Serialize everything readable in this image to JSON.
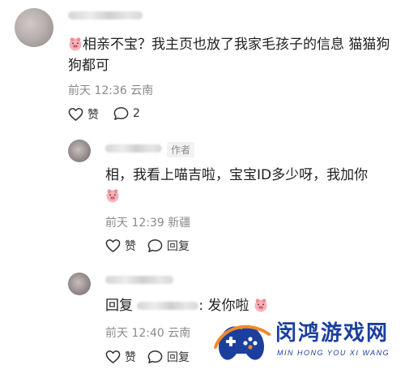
{
  "comment_main": {
    "text": "相亲不宝？我主页也放了我家毛孩子的信息 猫猫狗狗都可",
    "time": "前天 12:36",
    "location": "云南",
    "like_label": "赞",
    "reply_count": "2"
  },
  "reply_1": {
    "author_tag": "作者",
    "text": "相，我看上喵吉啦，宝宝ID多少呀，我加你",
    "time": "前天 12:39",
    "location": "新疆",
    "like_label": "赞",
    "reply_label": "回复"
  },
  "reply_2": {
    "prefix": "回复",
    "text": ": 发你啦",
    "time": "前天 12:40",
    "location": "云南",
    "like_label": "赞",
    "reply_label": "回复"
  },
  "watermark": {
    "title": "闵鸿游戏网",
    "subtitle": "MIN HONG YOU XI WANG"
  },
  "icons": {
    "like": "heart-icon",
    "comment": "comment-bubble-icon",
    "emoji": "pig-emoji-icon",
    "logo": "gamepad-logo-icon"
  }
}
